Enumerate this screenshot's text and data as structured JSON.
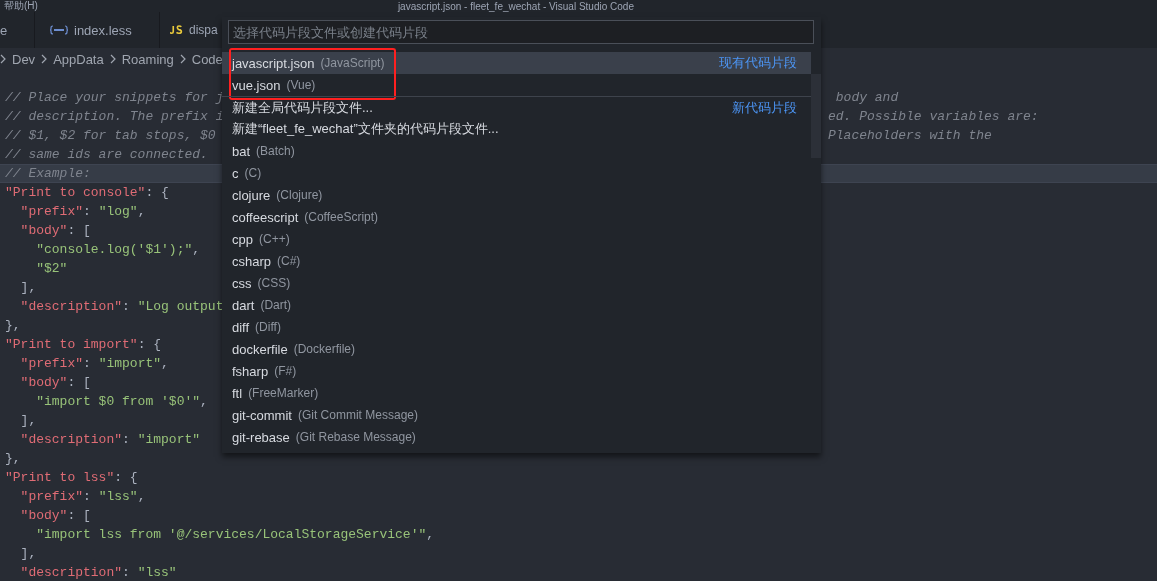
{
  "title_bar": {
    "menu": "帮助(H)",
    "title": "javascript.json - fleet_fe_wechat - Visual Studio Code"
  },
  "tabs": [
    {
      "label": "e",
      "kind": "plain"
    },
    {
      "label": "index.less",
      "kind": "less"
    },
    {
      "label": "dispa",
      "kind": "js"
    }
  ],
  "breadcrumb": [
    "Dev",
    "AppData",
    "Roaming",
    "Code"
  ],
  "editor": {
    "lines": [
      {
        "highlighted": false,
        "left": [
          {
            "kind": "comment",
            "text": "// Place your snippets for j"
          }
        ],
        "right": [
          {
            "kind": "comment",
            "text": " body and"
          }
        ]
      },
      {
        "highlighted": false,
        "left": [
          {
            "kind": "comment",
            "text": "// description. The prefix i"
          }
        ],
        "right": [
          {
            "kind": "comment",
            "text": "ed. Possible variables are:"
          }
        ]
      },
      {
        "highlighted": false,
        "left": [
          {
            "kind": "comment",
            "text": "// $1, $2 for tab stops, $0 "
          }
        ],
        "right": [
          {
            "kind": "comment",
            "text": "Placeholders with the"
          }
        ]
      },
      {
        "highlighted": false,
        "left": [
          {
            "kind": "comment",
            "text": "// same ids are connected."
          }
        ]
      },
      {
        "highlighted": true,
        "left": [
          {
            "kind": "comment",
            "text": "// Example:"
          }
        ]
      },
      {
        "highlighted": false,
        "left": [
          {
            "kind": "key",
            "text": "\"Print to console\""
          },
          {
            "kind": "punct",
            "text": ": {"
          }
        ]
      },
      {
        "highlighted": false,
        "left": [
          {
            "kind": "key",
            "text": "  \"prefix\""
          },
          {
            "kind": "punct",
            "text": ": "
          },
          {
            "kind": "string",
            "text": "\"log\""
          },
          {
            "kind": "punct",
            "text": ","
          }
        ]
      },
      {
        "highlighted": false,
        "left": [
          {
            "kind": "key",
            "text": "  \"body\""
          },
          {
            "kind": "punct",
            "text": ": ["
          }
        ]
      },
      {
        "highlighted": false,
        "left": [
          {
            "kind": "string",
            "text": "    \"console.log('$1');\""
          },
          {
            "kind": "punct",
            "text": ","
          }
        ]
      },
      {
        "highlighted": false,
        "left": [
          {
            "kind": "string",
            "text": "    \"$2\""
          }
        ]
      },
      {
        "highlighted": false,
        "left": [
          {
            "kind": "punct",
            "text": "  ],"
          }
        ]
      },
      {
        "highlighted": false,
        "left": [
          {
            "kind": "key",
            "text": "  \"description\""
          },
          {
            "kind": "punct",
            "text": ": "
          },
          {
            "kind": "string",
            "text": "\"Log output"
          }
        ]
      },
      {
        "highlighted": false,
        "left": [
          {
            "kind": "punct",
            "text": "},"
          }
        ]
      },
      {
        "highlighted": false,
        "left": [
          {
            "kind": "key",
            "text": "\"Print to import\""
          },
          {
            "kind": "punct",
            "text": ": {"
          }
        ]
      },
      {
        "highlighted": false,
        "left": [
          {
            "kind": "key",
            "text": "  \"prefix\""
          },
          {
            "kind": "punct",
            "text": ": "
          },
          {
            "kind": "string",
            "text": "\"import\""
          },
          {
            "kind": "punct",
            "text": ","
          }
        ]
      },
      {
        "highlighted": false,
        "left": [
          {
            "kind": "key",
            "text": "  \"body\""
          },
          {
            "kind": "punct",
            "text": ": ["
          }
        ]
      },
      {
        "highlighted": false,
        "left": [
          {
            "kind": "string",
            "text": "    \"import $0 from '$0'\""
          },
          {
            "kind": "punct",
            "text": ","
          }
        ]
      },
      {
        "highlighted": false,
        "left": [
          {
            "kind": "punct",
            "text": "  ],"
          }
        ]
      },
      {
        "highlighted": false,
        "left": [
          {
            "kind": "key",
            "text": "  \"description\""
          },
          {
            "kind": "punct",
            "text": ": "
          },
          {
            "kind": "string",
            "text": "\"import\""
          }
        ]
      },
      {
        "highlighted": false,
        "left": [
          {
            "kind": "punct",
            "text": "},"
          }
        ]
      },
      {
        "highlighted": false,
        "left": [
          {
            "kind": "key",
            "text": "\"Print to lss\""
          },
          {
            "kind": "punct",
            "text": ": {"
          }
        ]
      },
      {
        "highlighted": false,
        "left": [
          {
            "kind": "key",
            "text": "  \"prefix\""
          },
          {
            "kind": "punct",
            "text": ": "
          },
          {
            "kind": "string",
            "text": "\"lss\""
          },
          {
            "kind": "punct",
            "text": ","
          }
        ]
      },
      {
        "highlighted": false,
        "left": [
          {
            "kind": "key",
            "text": "  \"body\""
          },
          {
            "kind": "punct",
            "text": ": ["
          }
        ]
      },
      {
        "highlighted": false,
        "left": [
          {
            "kind": "string",
            "text": "    \"import lss from '@/services/LocalStorageService'\""
          },
          {
            "kind": "punct",
            "text": ","
          }
        ]
      },
      {
        "highlighted": false,
        "left": [
          {
            "kind": "punct",
            "text": "  ],"
          }
        ]
      },
      {
        "highlighted": false,
        "left": [
          {
            "kind": "key",
            "text": "  \"description\""
          },
          {
            "kind": "punct",
            "text": ": "
          },
          {
            "kind": "string",
            "text": "\"lss\""
          }
        ]
      }
    ]
  },
  "quick_pick": {
    "placeholder": "选择代码片段文件或创建代码片段",
    "items": [
      {
        "label": "javascript.json",
        "detail": "(JavaScript)",
        "group_label": "现有代码片段",
        "selected": true,
        "highlighted": true
      },
      {
        "label": "vue.json",
        "detail": "(Vue)",
        "selected": false,
        "highlighted": true
      },
      {
        "label": "新建全局代码片段文件...",
        "group_label": "新代码片段",
        "selected": false,
        "highlighted": false
      },
      {
        "label": "新建“fleet_fe_wechat”文件夹的代码片段文件...",
        "selected": false,
        "highlighted": false
      },
      {
        "label": "bat",
        "detail": "(Batch)",
        "selected": false,
        "highlighted": false
      },
      {
        "label": "c",
        "detail": "(C)",
        "selected": false,
        "highlighted": false
      },
      {
        "label": "clojure",
        "detail": "(Clojure)",
        "selected": false,
        "highlighted": false
      },
      {
        "label": "coffeescript",
        "detail": "(CoffeeScript)",
        "selected": false,
        "highlighted": false
      },
      {
        "label": "cpp",
        "detail": "(C++)",
        "selected": false,
        "highlighted": false
      },
      {
        "label": "csharp",
        "detail": "(C#)",
        "selected": false,
        "highlighted": false
      },
      {
        "label": "css",
        "detail": "(CSS)",
        "selected": false,
        "highlighted": false
      },
      {
        "label": "dart",
        "detail": "(Dart)",
        "selected": false,
        "highlighted": false
      },
      {
        "label": "diff",
        "detail": "(Diff)",
        "selected": false,
        "highlighted": false
      },
      {
        "label": "dockerfile",
        "detail": "(Dockerfile)",
        "selected": false,
        "highlighted": false
      },
      {
        "label": "fsharp",
        "detail": "(F#)",
        "selected": false,
        "highlighted": false
      },
      {
        "label": "ftl",
        "detail": "(FreeMarker)",
        "selected": false,
        "highlighted": false
      },
      {
        "label": "git-commit",
        "detail": "(Git Commit Message)",
        "selected": false,
        "highlighted": false
      },
      {
        "label": "git-rebase",
        "detail": "(Git Rebase Message)",
        "selected": false,
        "highlighted": false
      }
    ]
  }
}
